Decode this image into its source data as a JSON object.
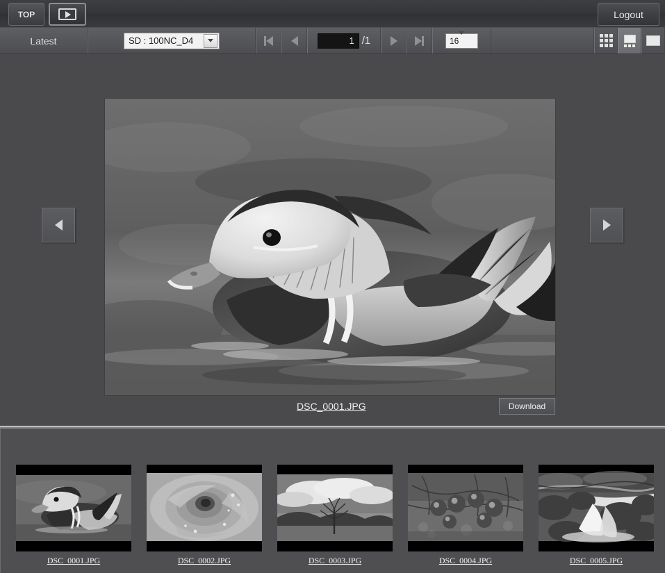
{
  "topbar": {
    "top_tab_label": "TOP",
    "viewer_tab_icon": "media-play-icon",
    "logout_label": "Logout"
  },
  "toolbar": {
    "latest_tab_label": "Latest",
    "folder_select_value": "SD : 100NC_D4",
    "first_page_icon": "first-page-icon",
    "prev_page_icon": "prev-page-icon",
    "page_value": "1",
    "page_total": "/1",
    "next_page_icon": "next-page-icon",
    "last_page_icon": "last-page-icon",
    "per_page_value": "16",
    "view_grid_icon": "grid-view-icon",
    "view_filmstrip_icon": "filmstrip-view-icon",
    "view_single_icon": "single-view-icon",
    "active_view": "filmstrip"
  },
  "main": {
    "prev_image_icon": "arrow-left-icon",
    "next_image_icon": "arrow-right-icon",
    "current_filename": "DSC_0001.JPG",
    "download_label": "Download",
    "image_subject": "mandarin duck on water, grayscale"
  },
  "thumbnails": [
    {
      "label": "DSC_0001.JPG",
      "subject": "mandarin duck on water"
    },
    {
      "label": "DSC_0002.JPG",
      "subject": "rose with water drops"
    },
    {
      "label": "DSC_0003.JPG",
      "subject": "lone tree with clouds and mountains"
    },
    {
      "label": "DSC_0004.JPG",
      "subject": "berries on branches"
    },
    {
      "label": "DSC_0005.JPG",
      "subject": "waterfall over rocks"
    }
  ],
  "colors": {
    "app_background": "#4a4a4d",
    "toolbar_background": "#55565a",
    "topbar_background": "#35363a",
    "text_primary": "#f0f0f0",
    "active_view_highlight": "#7a7b80"
  }
}
